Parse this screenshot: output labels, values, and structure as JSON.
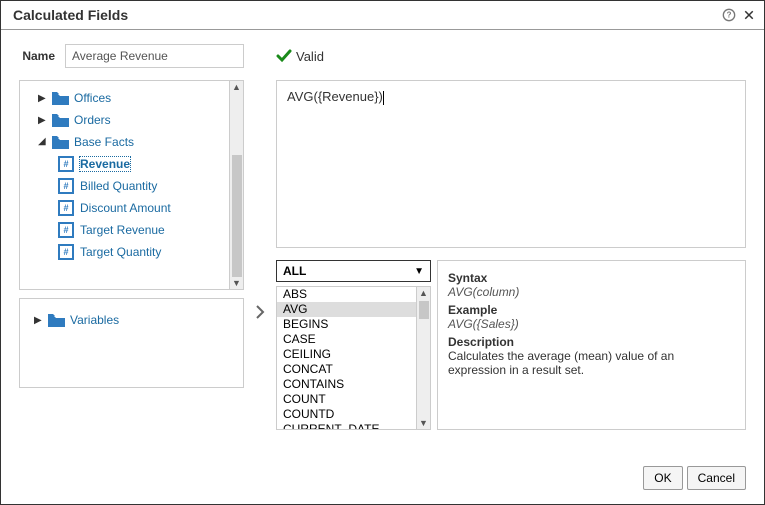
{
  "dialog": {
    "title": "Calculated Fields",
    "name_label": "Name",
    "name_value": "Average Revenue",
    "valid_label": "Valid",
    "formula": "AVG({Revenue})"
  },
  "tree": {
    "offices": "Offices",
    "orders": "Orders",
    "base_facts": "Base Facts",
    "revenue": "Revenue",
    "billed_quantity": "Billed Quantity",
    "discount_amount": "Discount Amount",
    "target_revenue": "Target Revenue",
    "target_quantity": "Target Quantity",
    "variables": "Variables"
  },
  "functions": {
    "filter": "ALL",
    "items": {
      "abs": "ABS",
      "avg": "AVG",
      "begins": "BEGINS",
      "case": "CASE",
      "ceiling": "CEILING",
      "concat": "CONCAT",
      "contains": "CONTAINS",
      "count": "COUNT",
      "countd": "COUNTD",
      "current_date": "CURRENT_DATE"
    }
  },
  "doc": {
    "syntax_head": "Syntax",
    "syntax_val": "AVG(column)",
    "example_head": "Example",
    "example_val": "AVG({Sales})",
    "desc_head": "Description",
    "desc_val": "Calculates the average (mean) value of an expression in a result set."
  },
  "buttons": {
    "ok": "OK",
    "cancel": "Cancel"
  }
}
